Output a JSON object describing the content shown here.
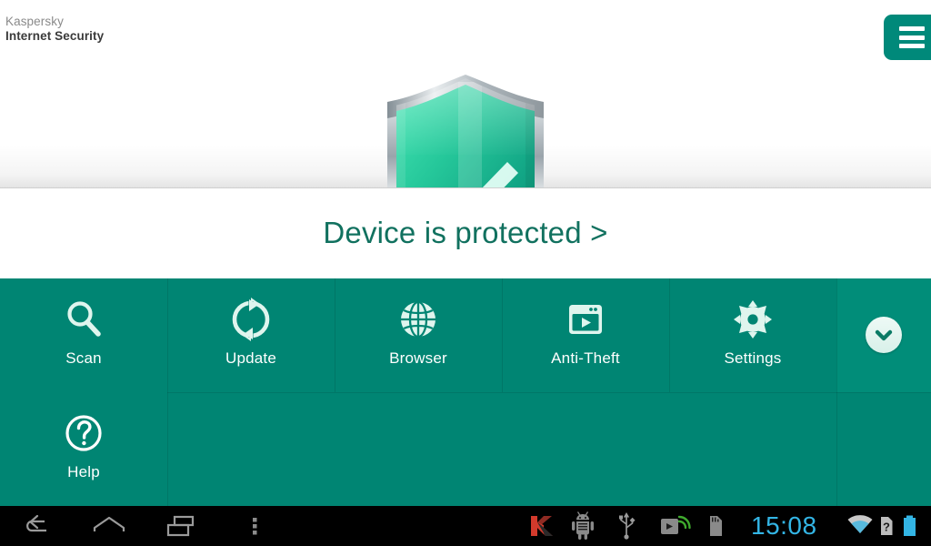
{
  "header": {
    "brand_line1": "Kaspersky",
    "brand_line2": "Internet Security",
    "menu_icon": "hamburger-menu-icon"
  },
  "hero": {
    "shield_icon": "protected-shield-icon",
    "shield_colors": {
      "green_light": "#3fe0b0",
      "green_mid": "#16b28e",
      "green_dark": "#0e8f74",
      "silver_light": "#f2f4f5",
      "silver_mid": "#b9c0c4",
      "silver_dark": "#7d8991"
    }
  },
  "status": {
    "text": "Device is protected >",
    "color": "#11715f"
  },
  "tiles": {
    "row1": [
      {
        "label": "Scan",
        "icon": "magnifier-icon"
      },
      {
        "label": "Update",
        "icon": "refresh-arrows-icon"
      },
      {
        "label": "Browser",
        "icon": "globe-icon"
      },
      {
        "label": "Anti-Theft",
        "icon": "window-play-icon"
      },
      {
        "label": "Settings",
        "icon": "gear-icon"
      }
    ],
    "row2": [
      {
        "label": "Help",
        "icon": "question-circle-icon"
      }
    ],
    "expand_icon": "chevron-down-icon",
    "background_color": "#008573",
    "label_color": "#ffffff"
  },
  "navbar": {
    "buttons": [
      {
        "name": "back",
        "icon": "back-arrow-icon"
      },
      {
        "name": "home",
        "icon": "home-icon"
      },
      {
        "name": "recents",
        "icon": "recents-icon"
      },
      {
        "name": "overflow",
        "icon": "overflow-dots-icon"
      }
    ],
    "tray": [
      {
        "name": "kaspersky-notification",
        "icon": "kaspersky-k-icon"
      },
      {
        "name": "android-notification",
        "icon": "android-robot-icon"
      },
      {
        "name": "usb-connected",
        "icon": "usb-icon"
      },
      {
        "name": "cast-active",
        "icon": "cast-icon"
      },
      {
        "name": "sd-card",
        "icon": "sd-card-icon"
      }
    ],
    "clock": "15:08",
    "clock_color": "#33b5e5",
    "status": [
      {
        "name": "wifi",
        "icon": "wifi-icon"
      },
      {
        "name": "no-sim",
        "icon": "sim-question-icon"
      },
      {
        "name": "battery",
        "icon": "battery-icon"
      }
    ]
  }
}
